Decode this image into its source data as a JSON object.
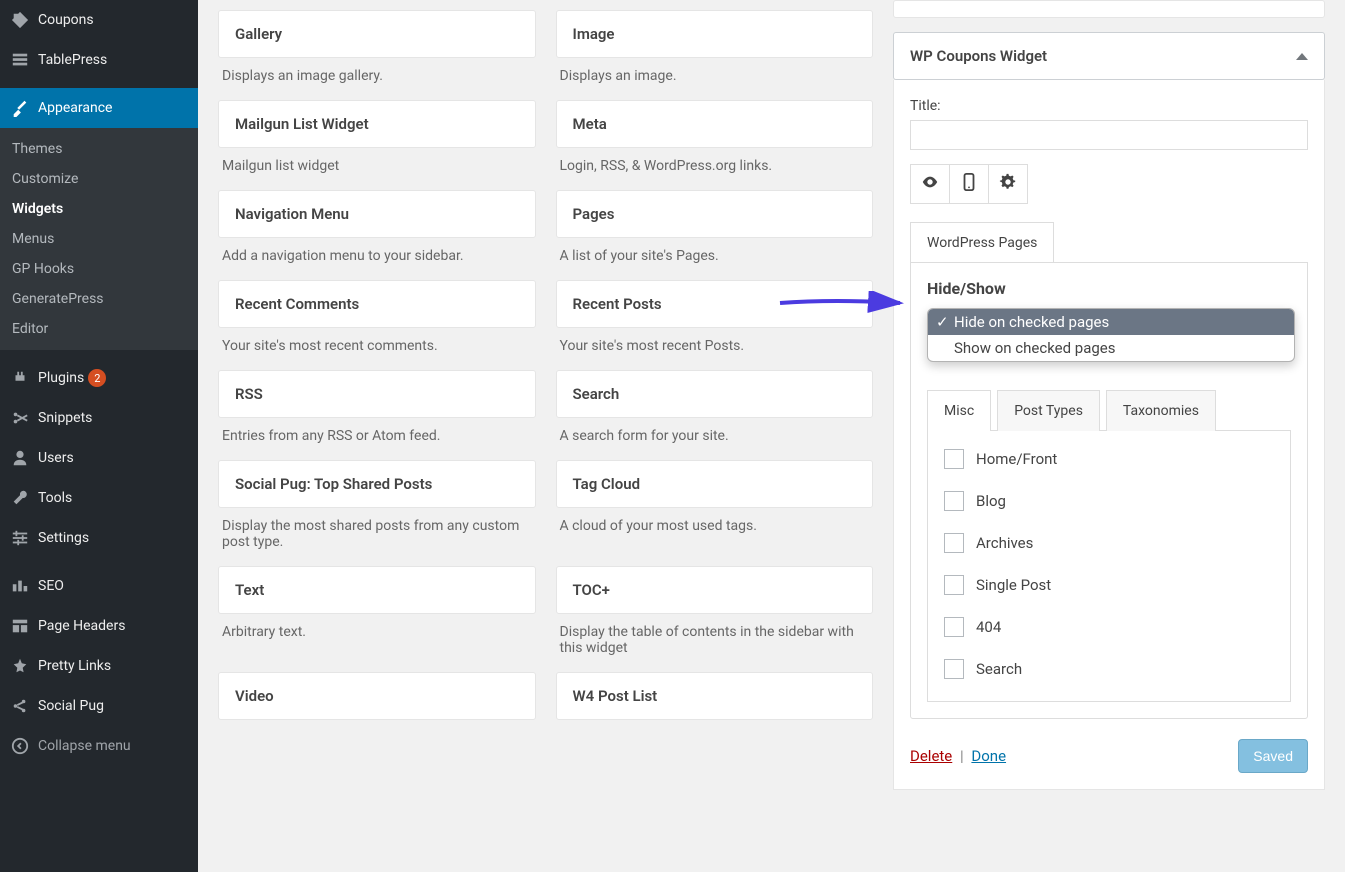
{
  "sidebar": {
    "coupons": "Coupons",
    "tablepress": "TablePress",
    "appearance": "Appearance",
    "sub": {
      "themes": "Themes",
      "customize": "Customize",
      "widgets": "Widgets",
      "menus": "Menus",
      "gp_hooks": "GP Hooks",
      "generatepress": "GeneratePress",
      "editor": "Editor"
    },
    "plugins": "Plugins",
    "plugins_badge": "2",
    "snippets": "Snippets",
    "users": "Users",
    "tools": "Tools",
    "settings": "Settings",
    "seo": "SEO",
    "page_headers": "Page Headers",
    "pretty_links": "Pretty Links",
    "social_pug": "Social Pug",
    "collapse": "Collapse menu"
  },
  "widgets": [
    {
      "title": "Gallery",
      "desc": "Displays an image gallery."
    },
    {
      "title": "Image",
      "desc": "Displays an image."
    },
    {
      "title": "Mailgun List Widget",
      "desc": "Mailgun list widget"
    },
    {
      "title": "Meta",
      "desc": "Login, RSS, & WordPress.org links."
    },
    {
      "title": "Navigation Menu",
      "desc": "Add a navigation menu to your sidebar."
    },
    {
      "title": "Pages",
      "desc": "A list of your site's Pages."
    },
    {
      "title": "Recent Comments",
      "desc": "Your site's most recent comments."
    },
    {
      "title": "Recent Posts",
      "desc": "Your site's most recent Posts."
    },
    {
      "title": "RSS",
      "desc": "Entries from any RSS or Atom feed."
    },
    {
      "title": "Search",
      "desc": "A search form for your site."
    },
    {
      "title": "Social Pug: Top Shared Posts",
      "desc": "Display the most shared posts from any custom post type."
    },
    {
      "title": "Tag Cloud",
      "desc": "A cloud of your most used tags."
    },
    {
      "title": "Text",
      "desc": "Arbitrary text."
    },
    {
      "title": "TOC+",
      "desc": "Display the table of contents in the sidebar with this widget"
    },
    {
      "title": "Video",
      "desc": ""
    },
    {
      "title": "W4 Post List",
      "desc": ""
    }
  ],
  "panel": {
    "title": "WP Coupons Widget",
    "title_label": "Title:",
    "title_value": "",
    "wp_pages_tab": "WordPress Pages",
    "hide_show": "Hide/Show",
    "dropdown_options": [
      "Hide on checked pages",
      "Show on checked pages"
    ],
    "inner_tabs": [
      "Misc",
      "Post Types",
      "Taxonomies"
    ],
    "checks": [
      "Home/Front",
      "Blog",
      "Archives",
      "Single Post",
      "404",
      "Search"
    ],
    "delete": "Delete",
    "done": "Done",
    "saved": "Saved"
  }
}
